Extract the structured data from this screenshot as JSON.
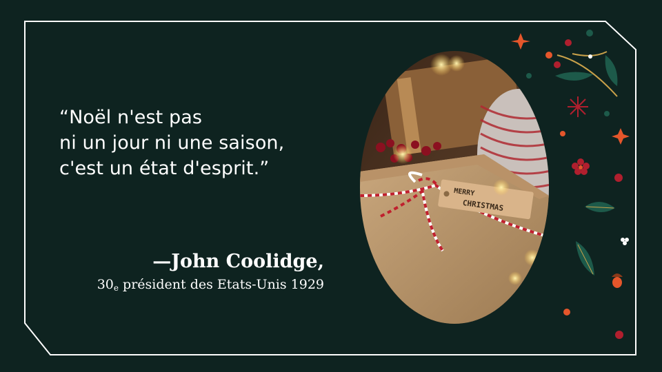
{
  "quote": {
    "line1": "“Noël n'est pas",
    "line2": "ni un jour ni une saison,",
    "line3": "c'est un état d'esprit.”"
  },
  "author": {
    "name": "—John Coolidge,",
    "role_prefix": "30",
    "role_suffix": "e",
    "role_rest": " président des Etats-Unis 1929"
  },
  "photo": {
    "tag_line1": "MERRY",
    "tag_line2": "CHRISTMAS"
  },
  "colors": {
    "background": "#0e2320",
    "frame": "#ffffff",
    "accent_orange": "#e5562b",
    "accent_red": "#b01f2e",
    "accent_green": "#1d5a4a",
    "gold": "#c9a14a"
  }
}
